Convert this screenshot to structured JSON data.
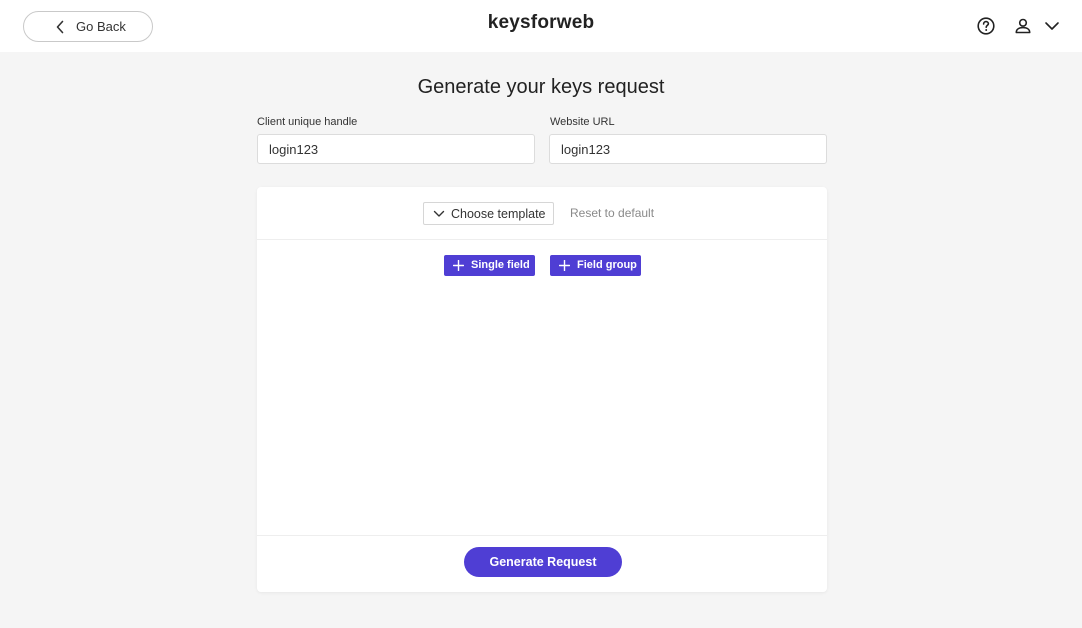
{
  "header": {
    "back_label": "Go Back",
    "logo_text": "keysforweb",
    "icons": [
      "chevron-left-icon",
      "help-icon",
      "user-icon",
      "chevron-down-icon"
    ]
  },
  "main": {
    "title": "Generate your keys request",
    "client_handle": {
      "label": "Client unique handle",
      "value": "login123"
    },
    "website_url": {
      "label": "Website URL",
      "value": "login123"
    }
  },
  "editor": {
    "template_label": "Choose template",
    "reset_label": "Reset to default",
    "single_field_label": "Single field",
    "field_group_label": "Field group",
    "submit_label": "Generate Request"
  },
  "colors": {
    "accent": "#4f3ed4",
    "background": "#f5f5f5",
    "card": "#ffffff"
  }
}
